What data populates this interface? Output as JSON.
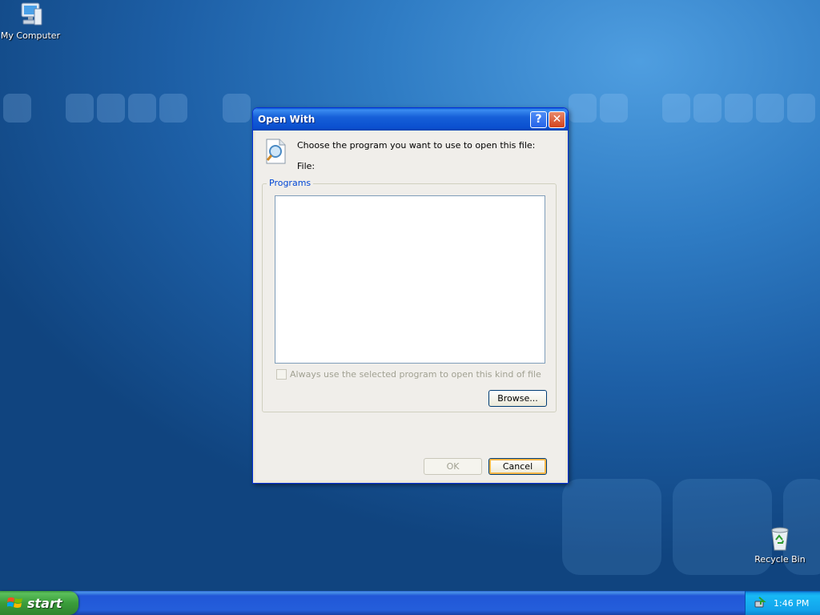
{
  "desktop": {
    "icons": [
      {
        "label": "My Computer",
        "icon": "computer-icon"
      },
      {
        "label": "Recycle Bin",
        "icon": "recycle-bin-icon"
      }
    ]
  },
  "dialog": {
    "title": "Open With",
    "help_glyph": "?",
    "close_glyph": "✕",
    "prompt": "Choose the program you want to use to open this file:",
    "file_label": "File:",
    "programs_group_title": "Programs",
    "always_use_label": "Always use the selected program to open this kind of file",
    "always_use_checked": false,
    "browse_label": "Browse...",
    "ok_label": "OK",
    "ok_enabled": false,
    "cancel_label": "Cancel"
  },
  "taskbar": {
    "start_label": "start",
    "clock": "1:46 PM"
  },
  "colors": {
    "dialog_border": "#0831d9",
    "group_title": "#0046d5",
    "start_green": "#3a9d3a",
    "taskbar_blue": "#245edb"
  }
}
